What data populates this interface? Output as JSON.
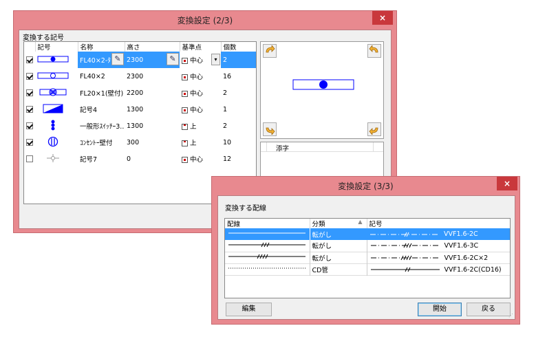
{
  "dialog1": {
    "title": "変換設定 (2/3)",
    "close": "×",
    "group_label": "変換する記号",
    "columns": [
      "記号",
      "名称",
      "高さ",
      "基準点",
      "個数"
    ],
    "rows": [
      {
        "checked": true,
        "symbol": "fl40x2-dot-icon",
        "name": "FL40×2-ﾀ",
        "height": "2300",
        "ref": "中心",
        "ref_icon": "center-point-icon",
        "count": "2",
        "selected": true
      },
      {
        "checked": true,
        "symbol": "fl40x2-ring-icon",
        "name": "FL40×2",
        "height": "2300",
        "ref": "中心",
        "ref_icon": "center-point-icon",
        "count": "16",
        "selected": false
      },
      {
        "checked": true,
        "symbol": "fl20x1-wall-icon",
        "name": "FL20×1(壁付)",
        "height": "2200",
        "ref": "中心",
        "ref_icon": "center-point-icon",
        "count": "2",
        "selected": false
      },
      {
        "checked": true,
        "symbol": "symbol4-icon",
        "name": "記号4",
        "height": "1300",
        "ref": "中心",
        "ref_icon": "center-point-icon",
        "count": "1",
        "selected": false
      },
      {
        "checked": true,
        "symbol": "switch-icon",
        "name": "一般形ｽｲｯﾁｰ3...",
        "height": "1300",
        "ref": "上",
        "ref_icon": "top-point-icon",
        "count": "2",
        "selected": false
      },
      {
        "checked": true,
        "symbol": "outlet-icon",
        "name": "ｺﾝｾﾝﾄｰ壁付",
        "height": "300",
        "ref": "上",
        "ref_icon": "top-point-icon",
        "count": "10",
        "selected": false
      },
      {
        "checked": false,
        "symbol": "symbol7-icon",
        "name": "記号7",
        "height": "0",
        "ref": "中心",
        "ref_icon": "center-point-icon",
        "count": "12",
        "selected": false
      }
    ],
    "attach_header": "添字"
  },
  "dialog2": {
    "title": "変換設定 (3/3)",
    "close": "×",
    "group_label": "変換する配線",
    "columns": [
      "配線",
      "分類",
      "記号"
    ],
    "rows": [
      {
        "line": "solid",
        "category": "転がし",
        "code": "VVF1.6-2C",
        "selected": true
      },
      {
        "line": "solid-3slash",
        "category": "転がし",
        "code": "VVF1.6-3C",
        "selected": false
      },
      {
        "line": "solid-4slash",
        "category": "転がし",
        "code": "VVF1.6-2C×2",
        "selected": false
      },
      {
        "line": "dotted",
        "category": "CD管",
        "code": "VVF1.6-2C(CD16)",
        "selected": false
      }
    ],
    "buttons": {
      "edit": "編集",
      "start": "開始",
      "back": "戻る"
    }
  },
  "colors": {
    "titlebar": "#e8898f",
    "close": "#c9383c",
    "selection": "#3399ff",
    "symbol_blue": "#0000ff"
  }
}
